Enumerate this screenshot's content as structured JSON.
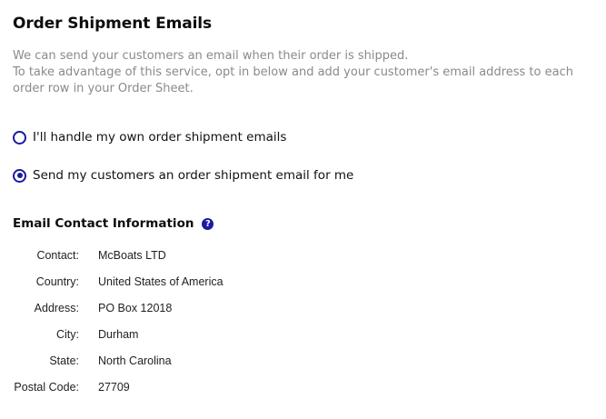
{
  "title": "Order Shipment Emails",
  "description": {
    "line1": "We can send your customers an email when their order is shipped.",
    "line2": "To take advantage of this service, opt in below and add your customer's email address to each",
    "line3": "order row in your Order Sheet."
  },
  "options": [
    {
      "label": "I'll handle my own order shipment emails",
      "selected": false
    },
    {
      "label": "Send my customers an order shipment email for me",
      "selected": true
    }
  ],
  "contact_section": {
    "heading": "Email Contact Information",
    "help_icon": "question-circle-icon",
    "help_glyph": "?",
    "rows": [
      {
        "label": "Contact:",
        "value": "McBoats LTD"
      },
      {
        "label": "Country:",
        "value": "United States of America"
      },
      {
        "label": "Address:",
        "value": "PO Box 12018"
      },
      {
        "label": "City:",
        "value": "Durham"
      },
      {
        "label": "State:",
        "value": "North Carolina"
      },
      {
        "label": "Postal Code:",
        "value": "27709"
      }
    ]
  },
  "colors": {
    "accent": "#1a1aa0",
    "muted_text": "#8a8a8a",
    "text": "#111111"
  }
}
